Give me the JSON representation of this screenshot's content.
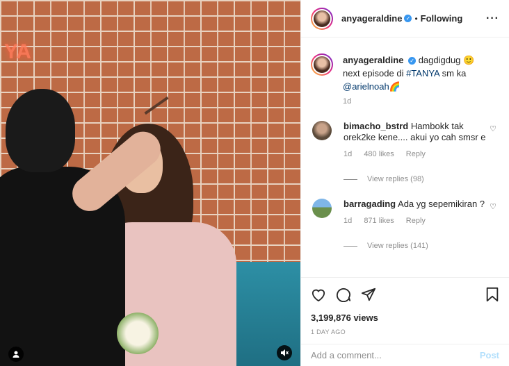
{
  "post": {
    "username": "anyageraldine",
    "verified_icon": "verified-badge-icon",
    "separator": "•",
    "follow_status": "Following",
    "more_icon": "more-options-icon",
    "neon_text": "YA"
  },
  "caption": {
    "username": "anyageraldine",
    "text_part1": "dagdigdug 🙂",
    "text_part2": "next episode di ",
    "hashtag": "#TANYA",
    "text_part3": " sm ka",
    "mention": "@arielnoah",
    "emoji": "🌈",
    "age": "1d"
  },
  "comments": [
    {
      "username": "bimacho_bstrd",
      "text": "Hambokk tak orek2ke kene.... akui yo cah smsr e",
      "age": "1d",
      "likes": "480 likes",
      "reply_label": "Reply",
      "view_replies": "View replies (98)"
    },
    {
      "username": "barragading",
      "text": "Ada yg sepemikiran ?",
      "age": "1d",
      "likes": "871 likes",
      "reply_label": "Reply",
      "view_replies": "View replies (141)"
    }
  ],
  "stats": {
    "views": "3,199,876 views",
    "date": "1 DAY AGO"
  },
  "compose": {
    "placeholder": "Add a comment...",
    "post_label": "Post"
  },
  "colors": {
    "link": "#00376b",
    "verified": "#3897f0",
    "muted": "#8e8e8e",
    "post_disabled": "#b2dffc"
  }
}
